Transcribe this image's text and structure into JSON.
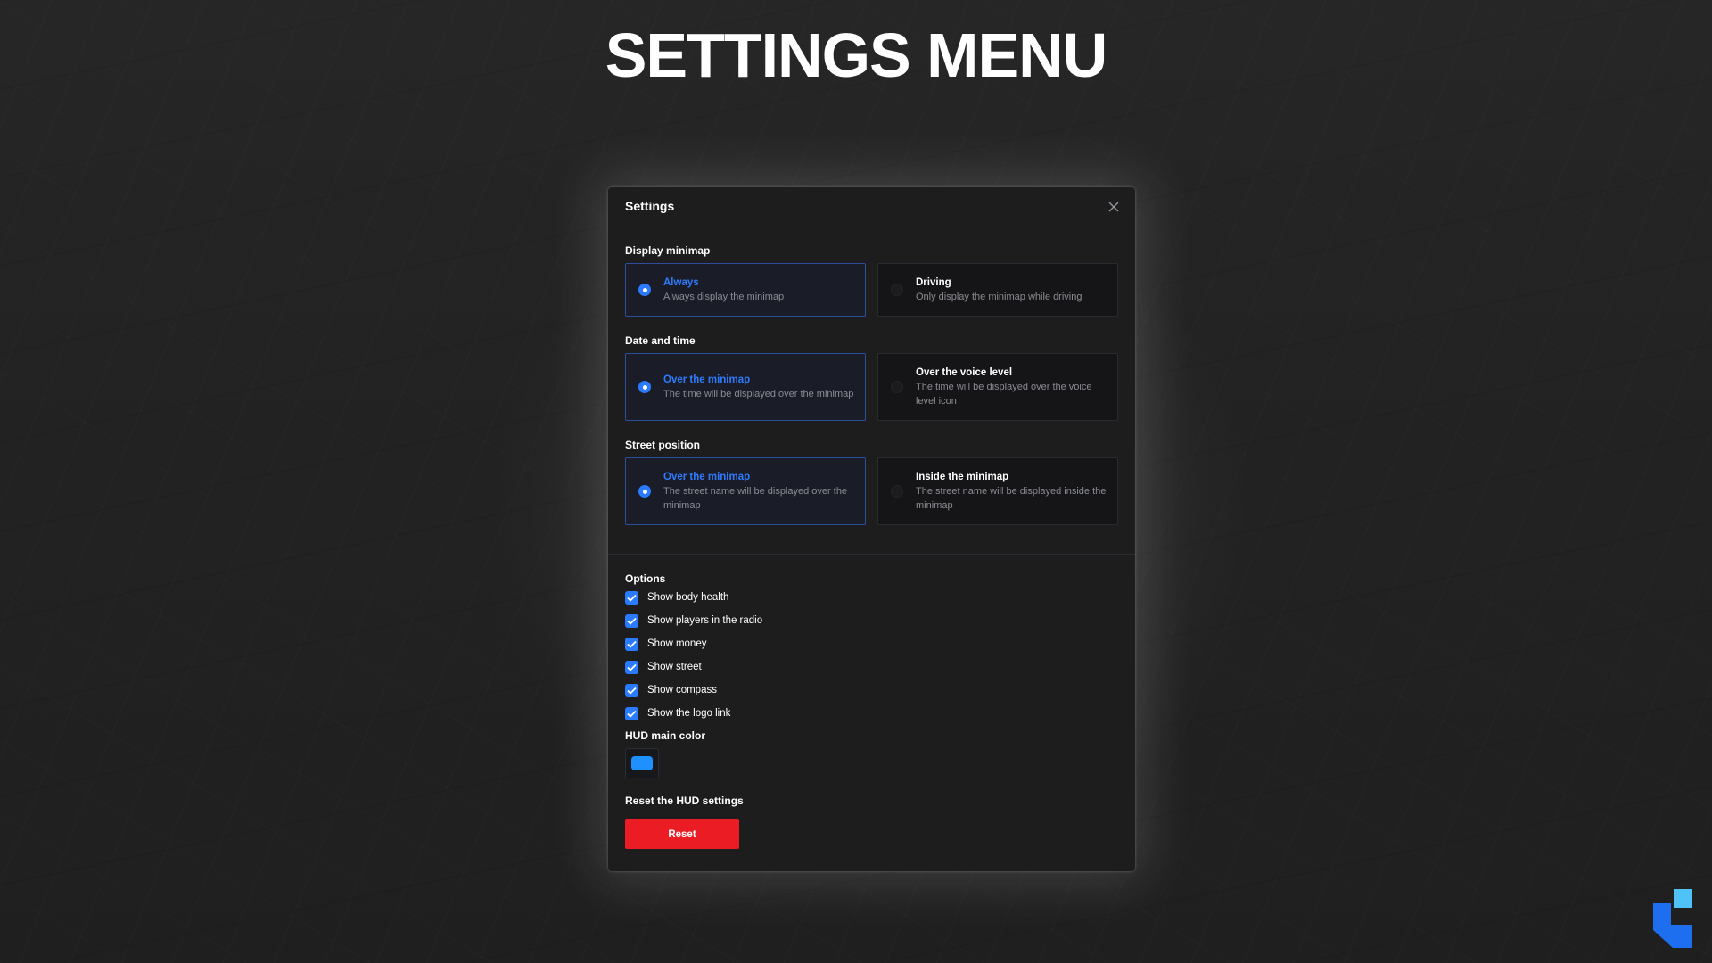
{
  "page": {
    "title": "SETTINGS MENU"
  },
  "dialog": {
    "title": "Settings",
    "close_icon": "close-icon"
  },
  "display_minimap": {
    "label": "Display minimap",
    "options": [
      {
        "title": "Always",
        "desc": "Always display the minimap",
        "selected": true
      },
      {
        "title": "Driving",
        "desc": "Only display the minimap while driving",
        "selected": false
      }
    ]
  },
  "date_time": {
    "label": "Date and time",
    "options": [
      {
        "title": "Over the minimap",
        "desc": "The time will be displayed over the minimap",
        "selected": true
      },
      {
        "title": "Over the voice level",
        "desc": "The time will be displayed over the voice level icon",
        "selected": false
      }
    ]
  },
  "street_position": {
    "label": "Street position",
    "options": [
      {
        "title": "Over the minimap",
        "desc": "The street name will be displayed over the minimap",
        "selected": true
      },
      {
        "title": "Inside the minimap",
        "desc": "The street name will be displayed inside the minimap",
        "selected": false
      }
    ]
  },
  "options": {
    "label": "Options",
    "items": [
      {
        "label": "Show body health",
        "checked": true
      },
      {
        "label": "Show players in the radio",
        "checked": true
      },
      {
        "label": "Show money",
        "checked": true
      },
      {
        "label": "Show street",
        "checked": true
      },
      {
        "label": "Show compass",
        "checked": true
      },
      {
        "label": "Show the logo link",
        "checked": true
      }
    ]
  },
  "hud_color": {
    "label": "HUD main color",
    "value": "#1e90ff"
  },
  "reset": {
    "label": "Reset the HUD settings",
    "button_label": "Reset"
  },
  "colors": {
    "accent": "#2a7bff",
    "danger": "#ec1c24",
    "logo_light": "#4fc3f7",
    "logo_dark": "#1e6ff0"
  }
}
